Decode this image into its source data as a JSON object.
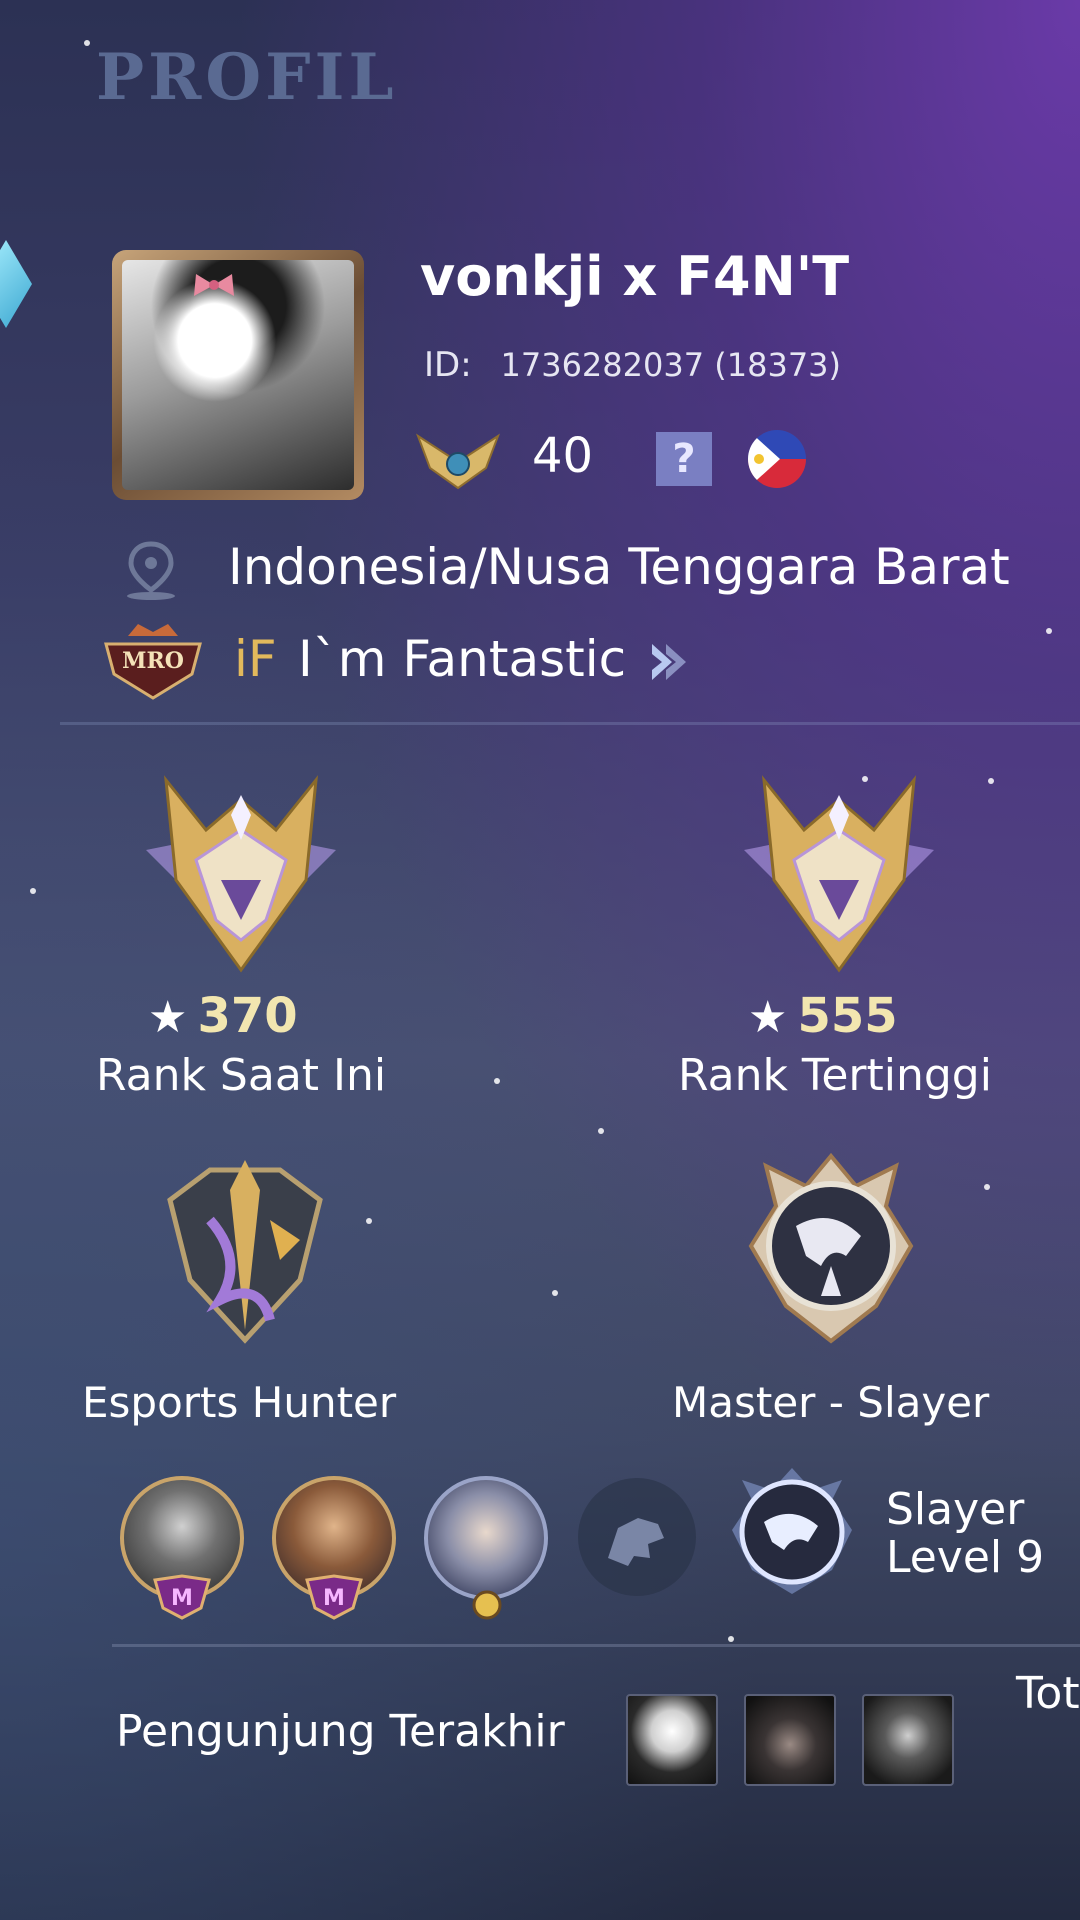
{
  "page": {
    "title": "PROFIL"
  },
  "profile": {
    "username": "vonkji x F4N'T",
    "id_label": "ID:",
    "id_value": "1736282037 (18373)",
    "level": "40",
    "help_symbol": "?",
    "location": "Indonesia/Nusa Tenggara Barat",
    "squad_badge_text": "MRO",
    "squad_tag": "iF",
    "squad_name": "I`m Fantastic"
  },
  "ranks": [
    {
      "stars": "370",
      "label": "Rank Saat Ini"
    },
    {
      "stars": "555",
      "label": "Rank Tertinggi"
    }
  ],
  "achievements": [
    {
      "label": "Esports Hunter"
    },
    {
      "label": "Master - Slayer"
    }
  ],
  "heroes": {
    "mastery_badge_letter": "M",
    "slayer_line1": "Slayer",
    "slayer_line2": "Level 9"
  },
  "visitors": {
    "label": "Pengunjung Terakhir",
    "total_partial": "Tot"
  },
  "colors": {
    "squad_tag": "#e2b95c",
    "help_bg": "#7a7fc2",
    "frame_gold": "#c9a46a"
  },
  "icons": [
    "location-pin-icon",
    "chevron-right-icon",
    "help-icon",
    "philippines-flag-icon",
    "level-badge-icon",
    "star-icon"
  ]
}
